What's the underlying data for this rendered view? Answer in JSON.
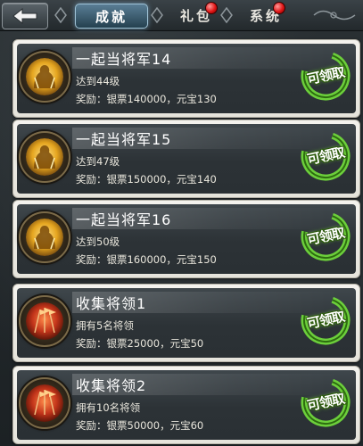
{
  "nav": {
    "tabs": [
      {
        "label": "成就",
        "active": true,
        "has_badge": false
      },
      {
        "label": "礼包",
        "active": false,
        "has_badge": true
      },
      {
        "label": "系统",
        "active": false,
        "has_badge": true
      }
    ]
  },
  "achievements": [
    {
      "title": "一起当将军14",
      "requirement": "达到44级",
      "reward": "奖励：银票140000，元宝130",
      "claim_label": "可领取",
      "icon": "general-silhouette-icon"
    },
    {
      "title": "一起当将军15",
      "requirement": "达到47级",
      "reward": "奖励：银票150000，元宝140",
      "claim_label": "可领取",
      "icon": "general-silhouette-icon"
    },
    {
      "title": "一起当将军16",
      "requirement": "达到50级",
      "reward": "奖励：银票160000，元宝150",
      "claim_label": "可领取",
      "icon": "general-silhouette-icon"
    },
    {
      "title": "收集将领1",
      "requirement": "拥有5名将领",
      "reward": "奖励：银票25000，元宝50",
      "claim_label": "可领取",
      "icon": "flags-icon"
    },
    {
      "title": "收集将领2",
      "requirement": "拥有10名将领",
      "reward": "奖励：银票50000，元宝60",
      "claim_label": "可领取",
      "icon": "flags-icon"
    }
  ],
  "colors": {
    "accent_green": "#6ccf3b",
    "badge_red": "#e01515",
    "active_tab": "#5a7e95"
  }
}
